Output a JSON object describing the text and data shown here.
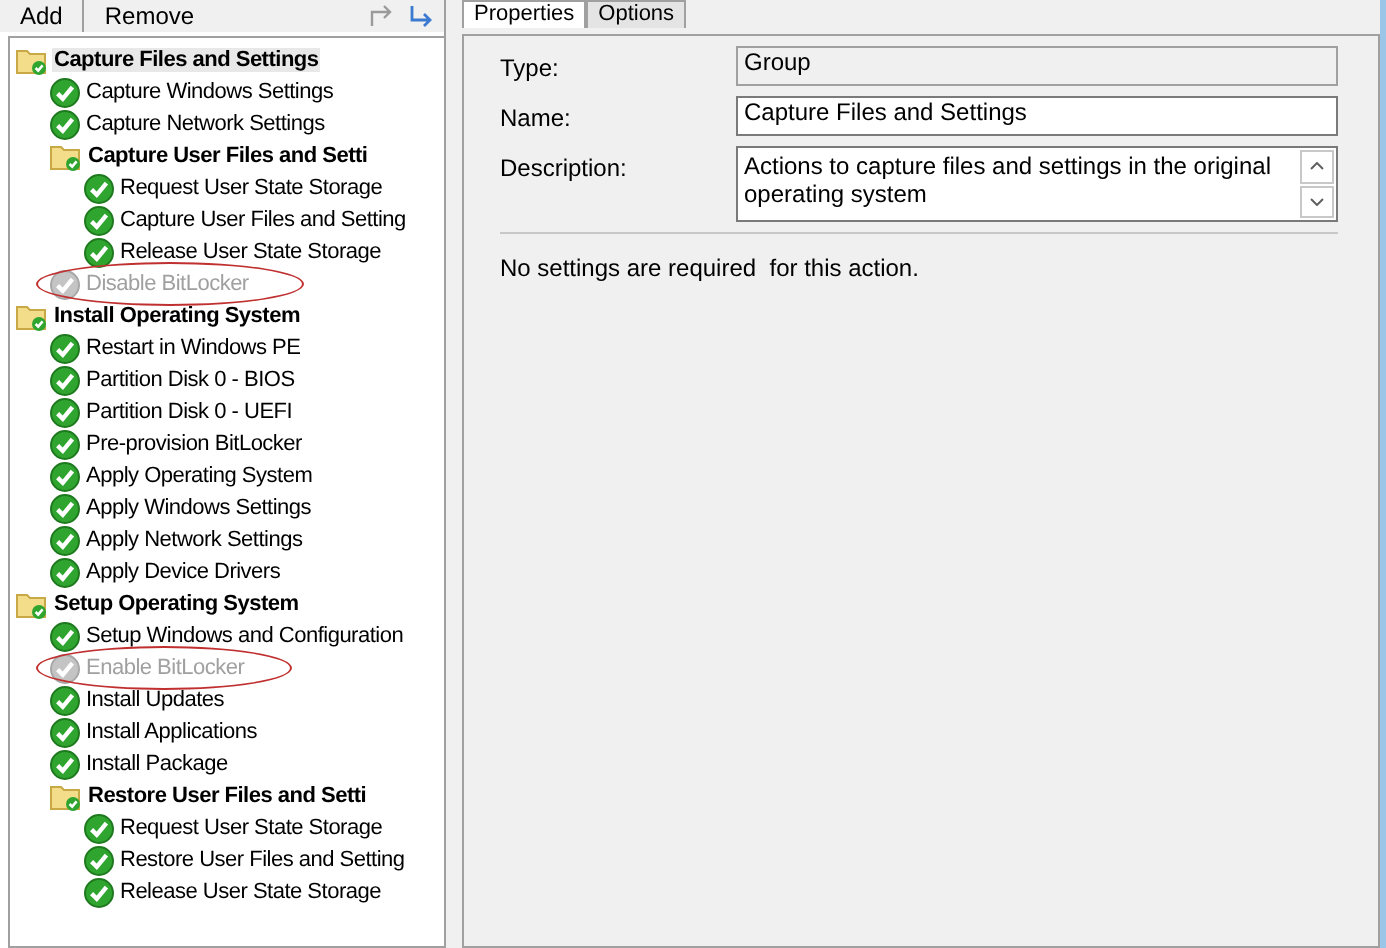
{
  "toolbar": {
    "add_label": "Add",
    "remove_label": "Remove"
  },
  "tree": [
    {
      "label": "Capture Files and Settings",
      "kind": "group",
      "selected": true,
      "disabled": false,
      "circled": false,
      "children": [
        {
          "label": "Capture Windows Settings",
          "kind": "step",
          "selected": false,
          "disabled": false,
          "circled": false
        },
        {
          "label": "Capture Network Settings",
          "kind": "step",
          "selected": false,
          "disabled": false,
          "circled": false
        },
        {
          "label": "Capture User Files and Setti",
          "kind": "group",
          "selected": false,
          "disabled": false,
          "circled": false,
          "children": [
            {
              "label": "Request User State Storage",
              "kind": "step",
              "selected": false,
              "disabled": false,
              "circled": false
            },
            {
              "label": "Capture User Files and Setting",
              "kind": "step",
              "selected": false,
              "disabled": false,
              "circled": false
            },
            {
              "label": "Release User State Storage",
              "kind": "step",
              "selected": false,
              "disabled": false,
              "circled": false
            }
          ]
        },
        {
          "label": "Disable BitLocker",
          "kind": "step",
          "selected": false,
          "disabled": true,
          "circled": true
        }
      ]
    },
    {
      "label": "Install Operating System",
      "kind": "group",
      "selected": false,
      "disabled": false,
      "circled": false,
      "children": [
        {
          "label": "Restart in Windows PE",
          "kind": "step",
          "selected": false,
          "disabled": false,
          "circled": false
        },
        {
          "label": "Partition Disk 0 - BIOS",
          "kind": "step",
          "selected": false,
          "disabled": false,
          "circled": false
        },
        {
          "label": "Partition Disk 0 - UEFI",
          "kind": "step",
          "selected": false,
          "disabled": false,
          "circled": false
        },
        {
          "label": "Pre-provision BitLocker",
          "kind": "step",
          "selected": false,
          "disabled": false,
          "circled": false
        },
        {
          "label": "Apply Operating System",
          "kind": "step",
          "selected": false,
          "disabled": false,
          "circled": false
        },
        {
          "label": "Apply Windows Settings",
          "kind": "step",
          "selected": false,
          "disabled": false,
          "circled": false
        },
        {
          "label": "Apply Network Settings",
          "kind": "step",
          "selected": false,
          "disabled": false,
          "circled": false
        },
        {
          "label": "Apply Device Drivers",
          "kind": "step",
          "selected": false,
          "disabled": false,
          "circled": false
        }
      ]
    },
    {
      "label": "Setup Operating System",
      "kind": "group",
      "selected": false,
      "disabled": false,
      "circled": false,
      "children": [
        {
          "label": "Setup Windows and Configuration",
          "kind": "step",
          "selected": false,
          "disabled": false,
          "circled": false
        },
        {
          "label": "Enable BitLocker",
          "kind": "step",
          "selected": false,
          "disabled": true,
          "circled": true
        },
        {
          "label": "Install Updates",
          "kind": "step",
          "selected": false,
          "disabled": false,
          "circled": false
        },
        {
          "label": "Install Applications",
          "kind": "step",
          "selected": false,
          "disabled": false,
          "circled": false
        },
        {
          "label": "Install Package",
          "kind": "step",
          "selected": false,
          "disabled": false,
          "circled": false
        },
        {
          "label": "Restore User Files and Setti",
          "kind": "group",
          "selected": false,
          "disabled": false,
          "circled": false,
          "children": [
            {
              "label": "Request User State Storage",
              "kind": "step",
              "selected": false,
              "disabled": false,
              "circled": false
            },
            {
              "label": "Restore User Files and Setting",
              "kind": "step",
              "selected": false,
              "disabled": false,
              "circled": false
            },
            {
              "label": "Release User State Storage",
              "kind": "step",
              "selected": false,
              "disabled": false,
              "circled": false
            }
          ]
        }
      ]
    }
  ],
  "tabs": [
    {
      "label": "Properties",
      "selected": true
    },
    {
      "label": "Options",
      "selected": false
    }
  ],
  "fields": [
    {
      "label": "Type:",
      "value": "Group",
      "readonly": true,
      "kind": "text"
    },
    {
      "label": "Name:",
      "value": "Capture Files and Settings",
      "readonly": false,
      "kind": "text"
    },
    {
      "label": "Description:",
      "value": "Actions to capture files and settings in the original operating system",
      "readonly": false,
      "kind": "multiline"
    }
  ],
  "note": "No settings are required  for this action."
}
